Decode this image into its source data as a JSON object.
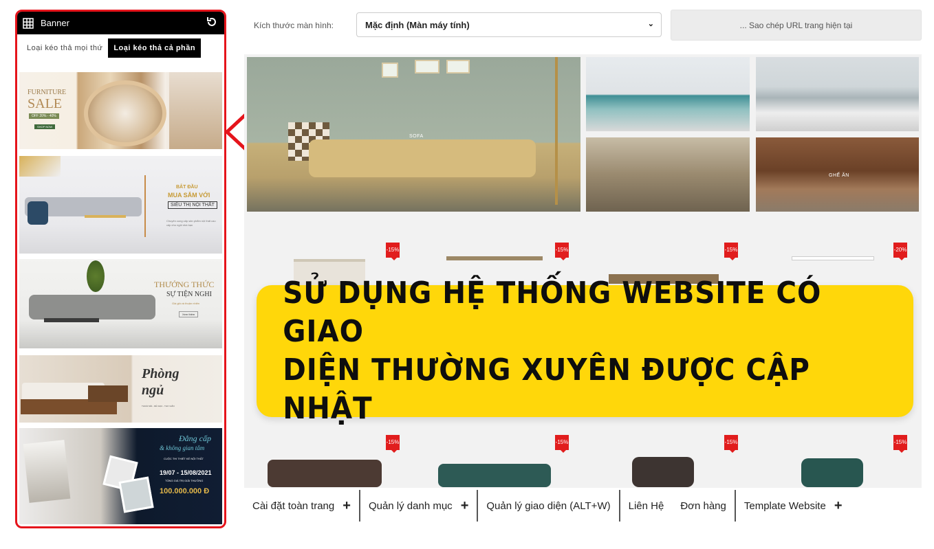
{
  "panel": {
    "title": "Banner",
    "tabs": [
      {
        "label": "Loại kéo thả mọi thứ",
        "active": false
      },
      {
        "label": "Loại kéo thả cả phần",
        "active": true
      }
    ],
    "banners": [
      {
        "name": "furniture-sale",
        "lines": [
          "FURNITURE",
          "SALE",
          "OFF 20% - 40%",
          "SHOP NOW"
        ]
      },
      {
        "name": "mua-sam",
        "lines": [
          "BẮT ĐẦU",
          "MUA SẮM VỚI",
          "SIÊU THỊ NỘI THẤT",
          "Chuyên cung cấp sản phẩm nội thất cao cấp cho ngôi nhà bạn"
        ]
      },
      {
        "name": "thuong-thuc",
        "lines": [
          "THƯỞNG THỨC",
          "SỰ TIỆN NGHI",
          "Giá giả và thuận nhiên",
          "Xem thêm"
        ]
      },
      {
        "name": "phong-ngu",
        "lines": [
          "Phòng",
          "ngủ",
          "THOẢI MÁI - DỄ CHỊU - THƯ GIÃN"
        ]
      },
      {
        "name": "dang-cap",
        "lines": [
          "Đẳng cấp",
          "& không gian tắm",
          "CUỘC THI THIẾT KẾ NỘI THẤT",
          "19/07 - 15/08/2021",
          "TỔNG GIÁ TRỊ GIẢI THƯỞNG",
          "100.000.000 Đ"
        ]
      }
    ]
  },
  "toolbar": {
    "screen_label": "Kích thước màn hình:",
    "screen_value": "Mặc định (Màn máy tính)",
    "copy_url": "... Sao chép URL trang hiện tại"
  },
  "site": {
    "hero_labels": [
      "SOFA",
      "GHẾ ĂN"
    ],
    "discounts_row1": [
      "-15%",
      "-15%",
      "-15%",
      "-20%"
    ],
    "discounts_row2": [
      "-15%",
      "-15%",
      "-15%",
      "-15%"
    ]
  },
  "yellow_banner": {
    "line1": "SỬ DỤNG HỆ THỐNG WEBSITE CÓ GIAO",
    "line2": "DIỆN THƯỜNG XUYÊN ĐƯỢC CẬP NHẬT"
  },
  "bottom_bar": [
    {
      "label": "Cài đặt toàn trang",
      "plus": true
    },
    {
      "label": "Quản lý danh mục",
      "plus": true
    },
    {
      "label": "Quản lý giao diện (ALT+W)",
      "plus": false
    },
    {
      "label": "Liên Hệ",
      "plus": false
    },
    {
      "label": "Đơn hàng",
      "plus": false
    },
    {
      "label": "Template Website",
      "plus": true
    }
  ],
  "colors": {
    "accent_red": "#e5141b",
    "banner_yellow": "#ffd70a",
    "discount": "#e11d1d"
  }
}
